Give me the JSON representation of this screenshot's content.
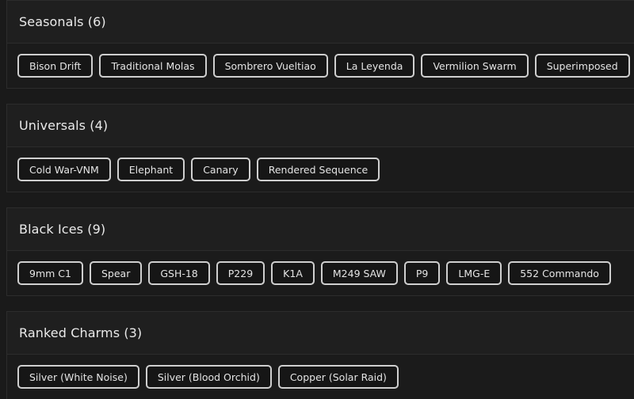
{
  "sections": [
    {
      "title": "Seasonals (6)",
      "items": [
        "Bison Drift",
        "Traditional Molas",
        "Sombrero Vueltiao",
        "La Leyenda",
        "Vermilion Swarm",
        "Superimposed"
      ]
    },
    {
      "title": "Universals (4)",
      "items": [
        "Cold War-VNM",
        "Elephant",
        "Canary",
        "Rendered Sequence"
      ]
    },
    {
      "title": "Black Ices (9)",
      "items": [
        "9mm C1",
        "Spear",
        "GSH-18",
        "P229",
        "K1A",
        "M249 SAW",
        "P9",
        "LMG-E",
        "552 Commando"
      ]
    },
    {
      "title": "Ranked Charms (3)",
      "items": [
        "Silver (White Noise)",
        "Silver (Blood Orchid)",
        "Copper (Solar Raid)"
      ]
    }
  ]
}
